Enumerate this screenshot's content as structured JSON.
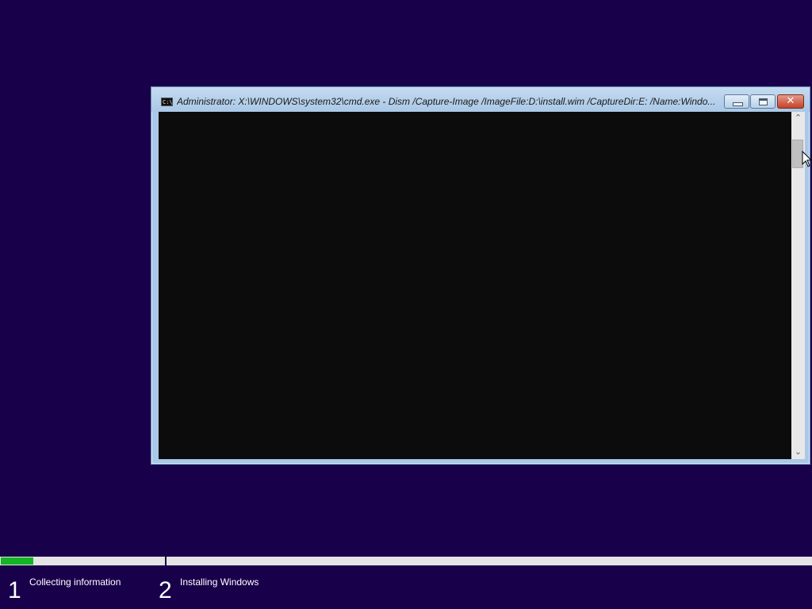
{
  "window": {
    "title": "Administrator: X:\\WINDOWS\\system32\\cmd.exe - Dism  /Capture-Image /ImageFile:D:\\install.wim /CaptureDir:E: /Name:Windo...",
    "icon": "cmd-icon",
    "icon_text": "C:\\",
    "buttons": {
      "minimize": "minimize-icon",
      "maximize": "maximize-icon",
      "close": "close-icon",
      "close_glyph": "✕"
    },
    "console_text": ""
  },
  "scrollbar": {
    "up_glyph": "⌃",
    "down_glyph": "⌄"
  },
  "setup": {
    "progress": 0.2,
    "steps": [
      {
        "number": "1",
        "label": "Collecting information"
      },
      {
        "number": "2",
        "label": "Installing Windows"
      }
    ]
  },
  "colors": {
    "background": "#19004b",
    "progress_fill": "#12b523",
    "progress_track": "#e4e4e4"
  }
}
